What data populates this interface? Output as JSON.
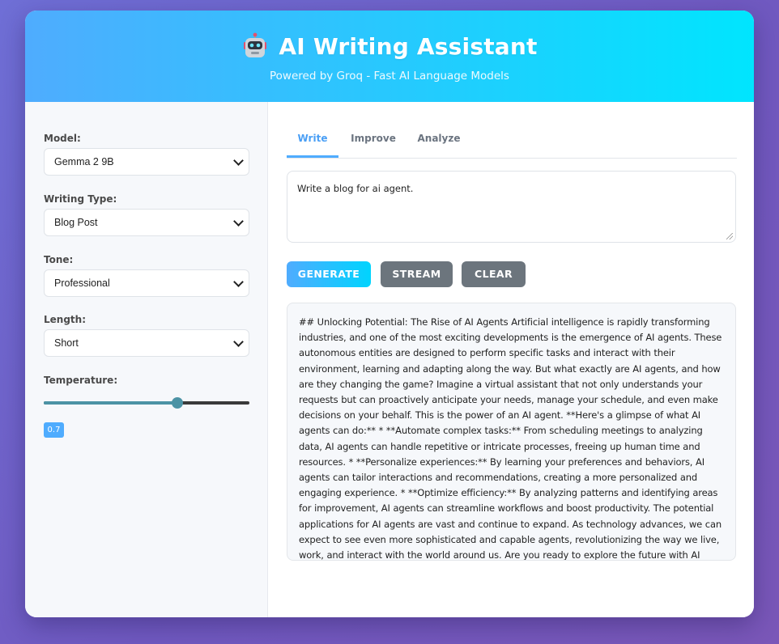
{
  "header": {
    "title": "AI Writing Assistant",
    "subtitle": "Powered by Groq - Fast AI Language Models",
    "icon": "robot-icon"
  },
  "sidebar": {
    "model": {
      "label": "Model:",
      "value": "Gemma 2 9B"
    },
    "writing_type": {
      "label": "Writing Type:",
      "value": "Blog Post"
    },
    "tone": {
      "label": "Tone:",
      "value": "Professional"
    },
    "length": {
      "label": "Length:",
      "value": "Short"
    },
    "temperature": {
      "label": "Temperature:",
      "value": "0.7",
      "level_fraction": 0.65
    }
  },
  "tabs": [
    {
      "label": "Write",
      "active": true
    },
    {
      "label": "Improve",
      "active": false
    },
    {
      "label": "Analyze",
      "active": false
    }
  ],
  "prompt": {
    "value": "Write a blog for ai agent."
  },
  "actions": {
    "generate": "GENERATE",
    "stream": "STREAM",
    "clear": "CLEAR"
  },
  "output": {
    "text": "## Unlocking Potential: The Rise of AI Agents Artificial intelligence is rapidly transforming industries, and one of the most exciting developments is the emergence of AI agents. These autonomous entities are designed to perform specific tasks and interact with their environment, learning and adapting along the way. But what exactly are AI agents, and how are they changing the game? Imagine a virtual assistant that not only understands your requests but can proactively anticipate your needs, manage your schedule, and even make decisions on your behalf. This is the power of an AI agent. **Here's a glimpse of what AI agents can do:** * **Automate complex tasks:** From scheduling meetings to analyzing data, AI agents can handle repetitive or intricate processes, freeing up human time and resources. * **Personalize experiences:** By learning your preferences and behaviors, AI agents can tailor interactions and recommendations, creating a more personalized and engaging experience. * **Optimize efficiency:** By analyzing patterns and identifying areas for improvement, AI agents can streamline workflows and boost productivity. The potential applications for AI agents are vast and continue to expand. As technology advances, we can expect to see even more sophisticated and capable agents, revolutionizing the way we live, work, and interact with the world around us. Are you ready to explore the future with AI agents?"
  },
  "colors": {
    "accent": "#4facfe",
    "accent_end": "#00e5fe",
    "secondary_button": "#6c757d",
    "slider_fill": "#4c93a5"
  }
}
